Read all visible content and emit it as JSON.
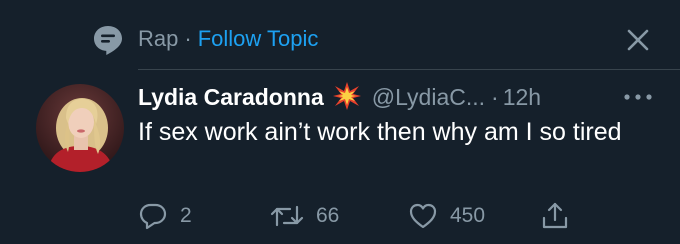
{
  "topic": {
    "icon": "topic-speech-bubble-icon",
    "name": "Rap",
    "separator": "·",
    "follow_label": "Follow Topic",
    "close_icon": "close-icon"
  },
  "tweet": {
    "display_name": "Lydia Caradonna",
    "badge_icon": "collision-emoji-icon",
    "handle": "@LydiaC...",
    "time_separator": "·",
    "timestamp": "12h",
    "more_icon": "more-dots-icon",
    "text": "If sex work ain’t work then why am I so tired"
  },
  "actions": {
    "reply": {
      "icon": "reply-icon",
      "count": "2"
    },
    "retweet": {
      "icon": "retweet-icon",
      "count": "66"
    },
    "like": {
      "icon": "heart-icon",
      "count": "450"
    },
    "share": {
      "icon": "share-icon"
    }
  },
  "colors": {
    "background": "#15202b",
    "muted": "#8899a6",
    "accent": "#1da1f2",
    "text": "#ffffff",
    "divider": "#38444d"
  }
}
